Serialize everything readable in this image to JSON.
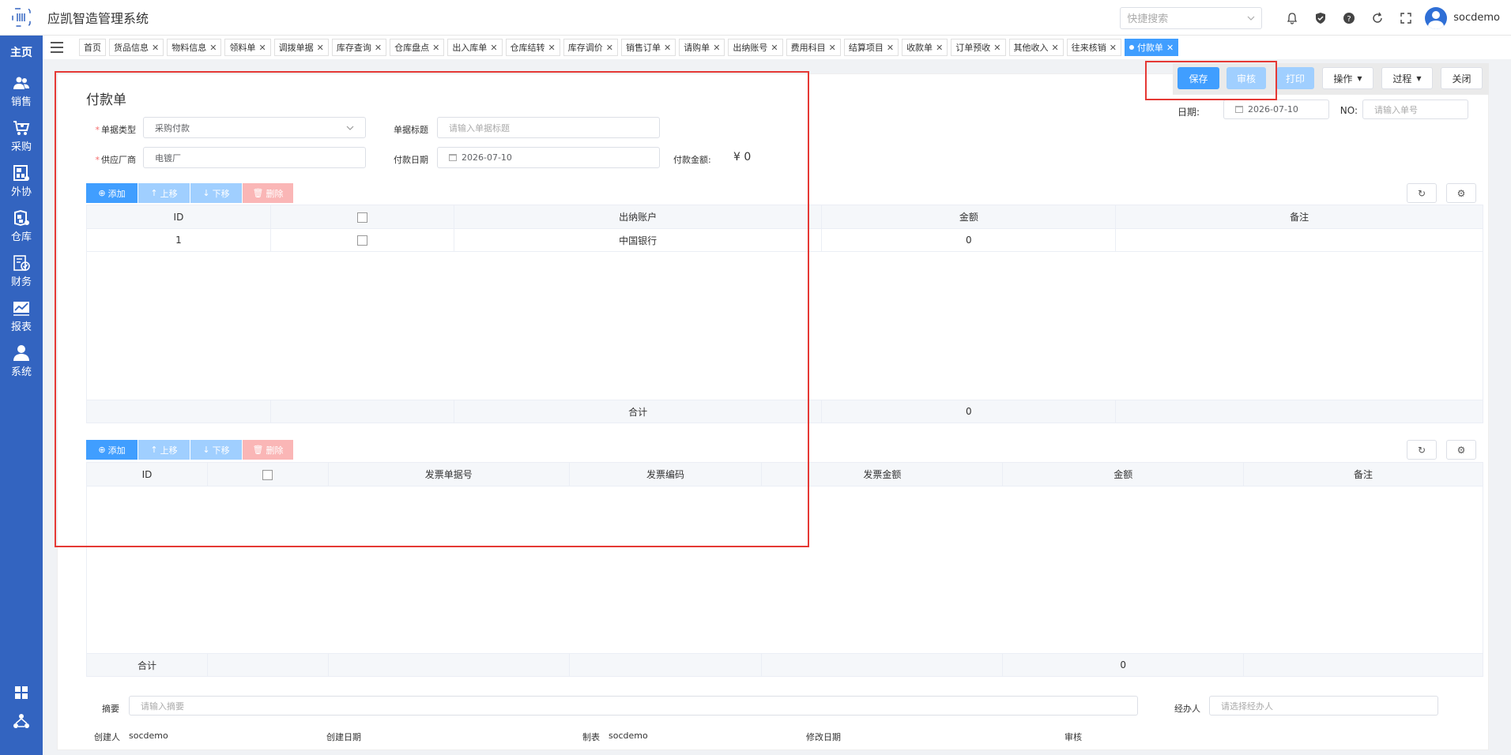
{
  "header": {
    "title": "应凯智造管理系统",
    "search_placeholder": "快捷搜索",
    "username": "socdemo"
  },
  "sidebar": {
    "home": "主页",
    "items": [
      {
        "label": "销售",
        "icon": "users-icon"
      },
      {
        "label": "采购",
        "icon": "cart-icon"
      },
      {
        "label": "外协",
        "icon": "outsource-icon"
      },
      {
        "label": "仓库",
        "icon": "warehouse-icon"
      },
      {
        "label": "财务",
        "icon": "finance-icon"
      },
      {
        "label": "报表",
        "icon": "report-icon"
      },
      {
        "label": "系统",
        "icon": "person-icon"
      }
    ]
  },
  "tabs": [
    {
      "label": "首页",
      "closable": false
    },
    {
      "label": "货品信息",
      "closable": true
    },
    {
      "label": "物料信息",
      "closable": true
    },
    {
      "label": "领料单",
      "closable": true
    },
    {
      "label": "调拨单据",
      "closable": true
    },
    {
      "label": "库存查询",
      "closable": true
    },
    {
      "label": "仓库盘点",
      "closable": true
    },
    {
      "label": "出入库单",
      "closable": true
    },
    {
      "label": "仓库结转",
      "closable": true
    },
    {
      "label": "库存调价",
      "closable": true
    },
    {
      "label": "销售订单",
      "closable": true
    },
    {
      "label": "请购单",
      "closable": true
    },
    {
      "label": "出纳账号",
      "closable": true
    },
    {
      "label": "费用科目",
      "closable": true
    },
    {
      "label": "结算项目",
      "closable": true
    },
    {
      "label": "收款单",
      "closable": true
    },
    {
      "label": "订单预收",
      "closable": true
    },
    {
      "label": "其他收入",
      "closable": true
    },
    {
      "label": "往来核销",
      "closable": true
    },
    {
      "label": "付款单",
      "closable": true,
      "active": true
    }
  ],
  "toolbar": {
    "save": "保存",
    "audit": "审核",
    "print": "打印",
    "operate": "操作",
    "process": "过程",
    "close": "关闭"
  },
  "doc": {
    "heading": "付款单",
    "date_label": "日期:",
    "date_value": "2026-07-10",
    "no_label": "NO:",
    "no_placeholder": "请输入单号"
  },
  "form": {
    "type_label": "单据类型",
    "type_value": "采购付款",
    "title_label": "单据标题",
    "title_placeholder": "请输入单据标题",
    "supplier_label": "供应厂商",
    "supplier_value": "电镀厂",
    "pay_date_label": "付款日期",
    "pay_date_value": "2026-07-10",
    "amount_label": "付款金额:",
    "amount_value": "¥ 0"
  },
  "grid_buttons": {
    "add": "添加",
    "up": "上移",
    "down": "下移",
    "del": "删除"
  },
  "grid1": {
    "headers": [
      "ID",
      "",
      "出纳账户",
      "金额",
      "备注"
    ],
    "rows": [
      [
        "1",
        "",
        "中国银行",
        "0",
        ""
      ]
    ],
    "total_label": "合计",
    "total_amount": "0"
  },
  "grid2": {
    "headers": [
      "ID",
      "",
      "发票单据号",
      "发票编码",
      "发票金额",
      "金额",
      "备注"
    ],
    "total_label": "合计",
    "total_amount": "0"
  },
  "footer": {
    "summary_label": "摘要",
    "summary_placeholder": "请输入摘要",
    "handler_label": "经办人",
    "handler_placeholder": "请选择经办人",
    "creator_label": "创建人",
    "creator_value": "socdemo",
    "created_date_label": "创建日期",
    "maker_label": "制表",
    "maker_value": "socdemo",
    "modified_date_label": "修改日期",
    "audit_label": "审核"
  },
  "colors": {
    "sidebar": "#3364c0",
    "primary": "#409eff",
    "primary_light": "#a0cfff",
    "danger_light": "#fab6b6",
    "highlight": "#e53935"
  }
}
